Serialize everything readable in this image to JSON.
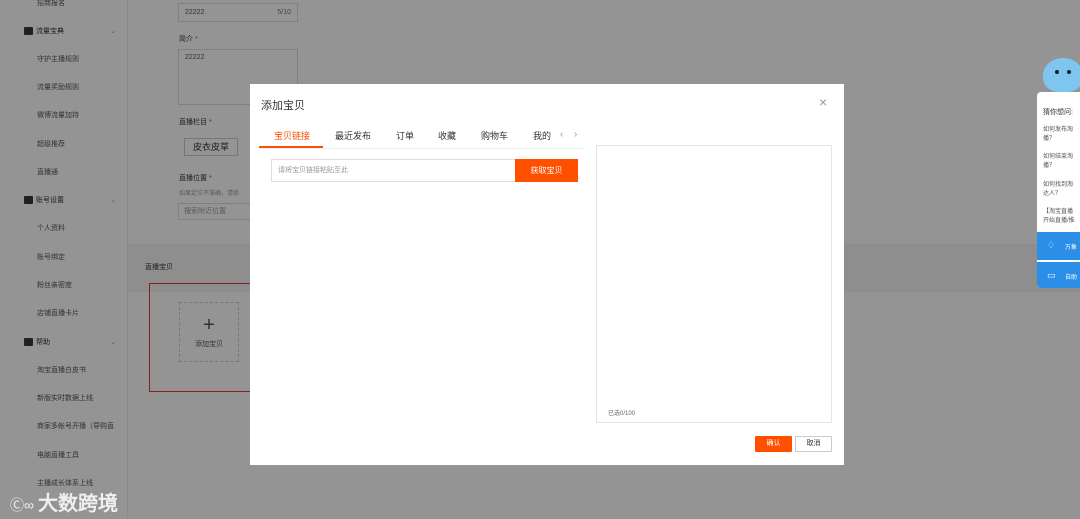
{
  "sidebar": {
    "top_item": "招商报名",
    "groups": [
      {
        "label": "流量宝典",
        "items": [
          "守护主播规则",
          "流量奖励规则",
          "微博流量加持",
          "超级推荐",
          "直播通"
        ]
      },
      {
        "label": "账号设置",
        "items": [
          "个人资料",
          "账号绑定",
          "粉丝亲密度",
          "店铺直播卡片"
        ]
      },
      {
        "label": "帮助",
        "items": [
          "淘宝直播白皮书",
          "新版实时数据上线",
          "商家多帐号开播（导购直",
          "电脑直播工具",
          "主播成长体系上线"
        ]
      }
    ]
  },
  "form": {
    "title_value": "22222",
    "title_count": "5/10",
    "intro_label": "简介",
    "intro_value": "22222",
    "column_label": "直播栏目",
    "column_value": "皮衣皮草",
    "location_label": "直播位置",
    "location_hint": "如果定位不准确，请修",
    "location_placeholder": "搜索附近位置",
    "required_mark": "*"
  },
  "products_section": {
    "title": "直播宝贝",
    "add_label": "添加宝贝",
    "add_symbol": "+"
  },
  "modal": {
    "title": "添加宝贝",
    "close_symbol": "×",
    "tabs": [
      "宝贝链接",
      "最近发布",
      "订单",
      "收藏",
      "购物车",
      "我的"
    ],
    "active_tab": "宝贝链接",
    "nav_prev": "‹",
    "nav_next": "›",
    "link_placeholder": "请将宝贝链接粘贴至此",
    "fetch_label": "获取宝贝",
    "selected_count": "已选0/100",
    "confirm_label": "确认",
    "cancel_label": "取消"
  },
  "help_widget": {
    "heading": "猜你想问:",
    "questions": [
      "如何发布淘\n播？",
      "如何结束淘\n播？",
      "如何找到淘\n达人？",
      "【淘宝直播\n开始直播/推"
    ],
    "actions": [
      "万象",
      "自助"
    ]
  },
  "watermark": {
    "text": "大数跨境",
    "logo": "Ⓒ∞"
  },
  "colors": {
    "accent": "#ff5000",
    "required": "#ee3333",
    "help_blue": "#2b8fe8"
  }
}
